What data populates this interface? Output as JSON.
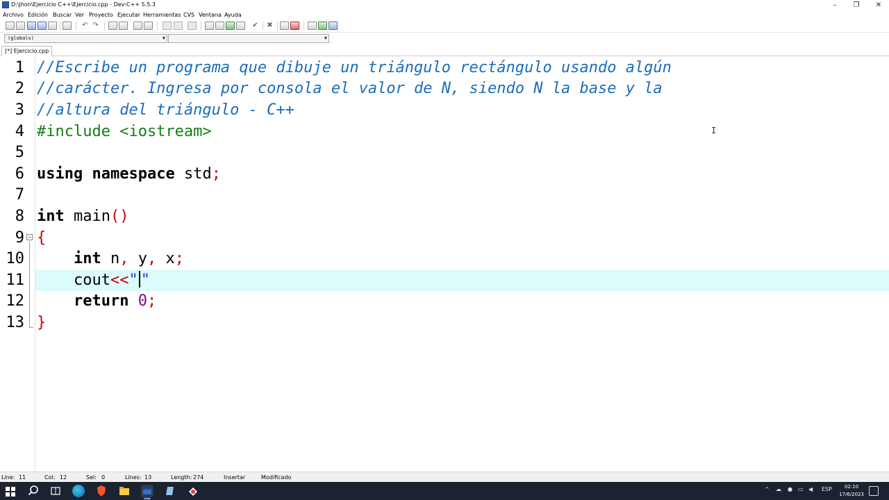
{
  "window": {
    "title": "D:\\jhon\\Ejercicio C++\\Ejercicio.cpp - Dev-C++ 5.5.3",
    "minimize": "–",
    "maximize": "❐",
    "close": "✕"
  },
  "menu": [
    "Archivo",
    "Edición",
    "Buscar",
    "Ver",
    "Proyecto",
    "Ejecutar",
    "Herramientas",
    "CVS",
    "Ventana",
    "Ayuda"
  ],
  "combos": {
    "scope": "(globals)",
    "members": ""
  },
  "tab": {
    "label": "[*] Ejercicio.cpp"
  },
  "editor": {
    "line_numbers": [
      "1",
      "2",
      "3",
      "4",
      "5",
      "6",
      "7",
      "8",
      "9",
      "10",
      "11",
      "12",
      "13"
    ],
    "current_line": 11,
    "lines": {
      "l1": "//Escribe un programa que dibuje un triángulo rectángulo usando algún",
      "l2": "//carácter. Ingresa por consola el valor de N, siendo N la base y la",
      "l3": "//altura del triángulo - C++",
      "l4": "#include <iostream>",
      "l6_kw1": "using",
      "l6_kw2": "namespace",
      "l6_id": "std",
      "l6_semi": ";",
      "l8_kw": "int",
      "l8_id": "main",
      "l8_paren": "()",
      "l9_brace": "{",
      "l10_kw": "int",
      "l10_n": "n",
      "l10_comma1": ",",
      "l10_y": "y",
      "l10_comma2": ",",
      "l10_x": "x",
      "l10_semi": ";",
      "l11_id": "cout",
      "l11_op": "<<",
      "l11_q1": "\"",
      "l11_q2": "\"",
      "l12_kw": "return",
      "l12_num": "0",
      "l12_semi": ";",
      "l13_brace": "}"
    }
  },
  "status": {
    "line_label": "Line:",
    "line_value": "11",
    "col_label": "Col:",
    "col_value": "12",
    "sel_label": "Sel:",
    "sel_value": "0",
    "lines_label": "Lines:",
    "lines_value": "13",
    "length_label": "Length:",
    "length_value": "274",
    "mode": "Insertar",
    "state": "Modificado"
  },
  "taskbar": {
    "language": "ESP",
    "time": "02:10",
    "date": "17/6/2023",
    "tray_up": "^"
  },
  "colors": {
    "comment": "#1a6ebd",
    "preprocessor": "#177d17",
    "symbol": "#c80000",
    "number": "#8b008b",
    "current_line": "#dcfbfb",
    "taskbar": "#1c2330"
  }
}
